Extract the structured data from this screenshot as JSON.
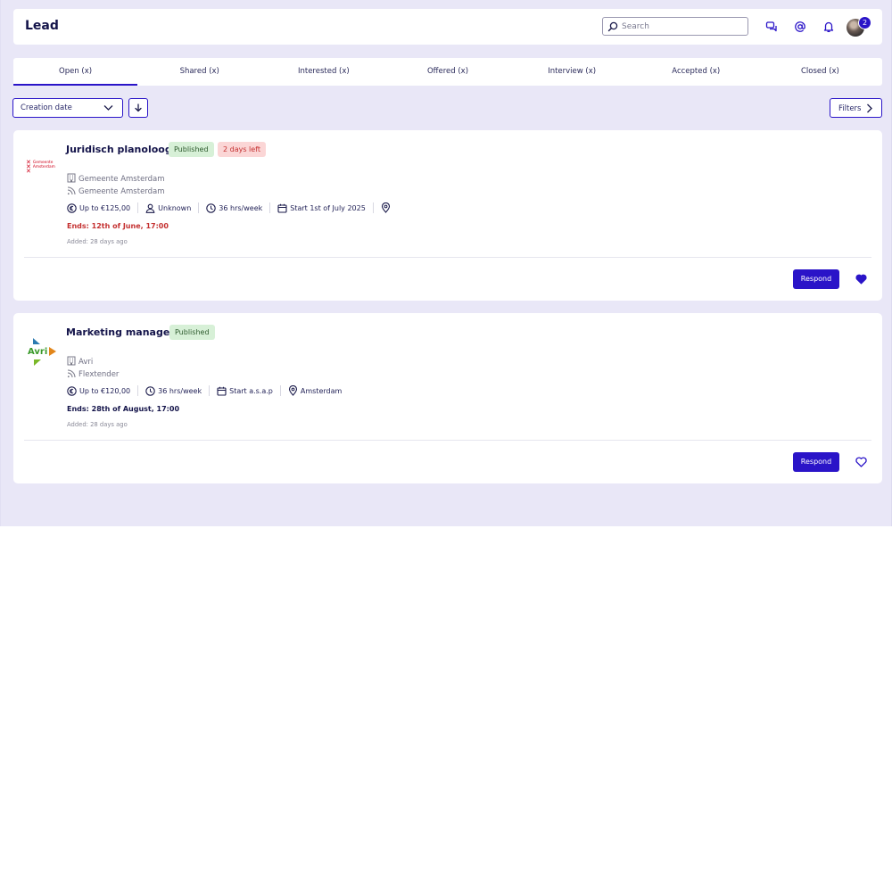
{
  "header": {
    "brand": "Lead",
    "search_placeholder": "Search",
    "notification_count": "2",
    "icons": [
      "chat-icon",
      "at-icon",
      "bell-icon",
      "avatar"
    ]
  },
  "tabs": [
    {
      "label": "Open (x)",
      "active": true
    },
    {
      "label": "Shared (x)"
    },
    {
      "label": "Interested (x)"
    },
    {
      "label": "Offered (x)"
    },
    {
      "label": "Interview (x)"
    },
    {
      "label": "Accepted (x)"
    },
    {
      "label": "Closed (x)"
    }
  ],
  "toolbar": {
    "sort_label": "Creation date",
    "filters_label": "Filters"
  },
  "colors": {
    "accent": "#2a14c8",
    "background": "#e9e7f7",
    "published_bg": "#d7f0d7",
    "deadline_bg": "#fbd6d6",
    "deadline_text": "#c43030"
  },
  "jobs": [
    {
      "title": "Juridisch planoloog",
      "status": "Published",
      "deadline_badge": "2 days left",
      "logo_text": [
        "Gemeente",
        "Amsterdam"
      ],
      "organization": "Gemeente Amsterdam",
      "channel": "Gemeente Amsterdam",
      "rate": "Up to €125,00",
      "contact": "Unknown",
      "hours": "36 hrs/week",
      "start": "Start 1st of July 2025",
      "ends": "Ends: 12th of June, 17:00",
      "added": "Added: 28 days ago",
      "respond_label": "Respond",
      "favorited": true
    },
    {
      "title": "Marketing manager",
      "status": "Published",
      "logo_text": "Avri",
      "organization": "Avri",
      "channel": "Flextender",
      "rate": "Up to €120,00",
      "hours": "36 hrs/week",
      "start": "Start a.s.a.p",
      "location": "Amsterdam",
      "ends": "Ends: 28th of August, 17:00",
      "added": "Added: 28 days ago",
      "respond_label": "Respond",
      "favorited": false
    }
  ]
}
